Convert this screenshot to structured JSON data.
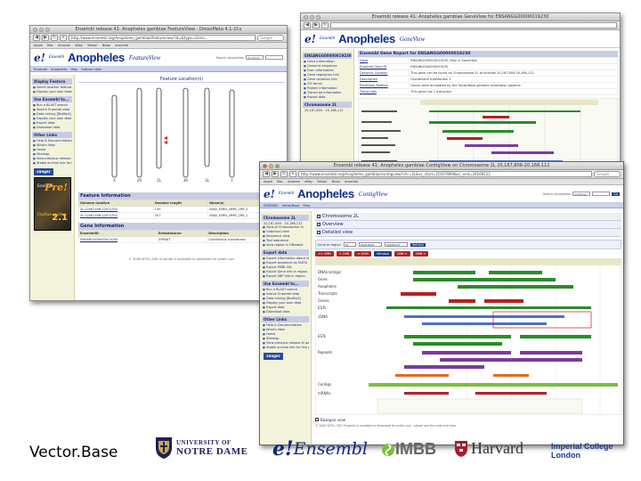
{
  "feature_window": {
    "title": "Ensembl release 41: Anopheles gambiae FeatureView - DrosoMeta 4.1-1f.x",
    "url": "http://www.ensembl.org/Anopheles_gambiae/featureview?id=&type=Gene...",
    "search_placeholder": "Google",
    "bookmarks": [
      "Apple",
      "Mac",
      "Amazon",
      "eBay",
      "Yahoo!",
      "News",
      "ensembl"
    ],
    "app_name": "Anopheles",
    "view_name": "FeatureView",
    "search_label": "Search Anopheles",
    "search_select": "Anything",
    "nav": [
      "Ensembl",
      "Anopheles",
      "Help",
      "Feature view"
    ],
    "sidebar": {
      "display_head": "Display Feature",
      "display_items": [
        "Select another feature to display",
        "Display your own features on a karyotype"
      ],
      "use_head": "Use Ensembl to...",
      "use_items": [
        "Run a BLAST search",
        "Search Ensembl data",
        "Data mining [BioMart]",
        "Display your own data",
        "Export data",
        "Download data"
      ],
      "links_head": "Other Links",
      "links_items": [
        "Help & Documentation",
        "What's New",
        "Home",
        "Sitemap",
        "View previous release of page in archive",
        "Stable archive link for this page"
      ],
      "sanger": "sanger",
      "pre_label": "Pre!",
      "pre_site": "Ensembl",
      "pre_species": "Gallus gallus",
      "pre_version": "2.1"
    },
    "panel_title": "Feature Location(s)",
    "info_title": "Feature Information",
    "info_headers": [
      "Genome location",
      "Genome length",
      "Name(s)"
    ],
    "info_rows": [
      [
        "2L:22067456-22071532",
        "149",
        "ARAV_EMBL_MMR_2R6_1"
      ],
      [
        "2L:22067456-22071531",
        "357",
        "ARAV_EMBL_MMR_2R6_1"
      ]
    ],
    "gene_title": "Gene Information",
    "gene_headers": [
      "EnsemblID",
      "Extdatatorun",
      "Description"
    ],
    "gene_rows": [
      [
        "ENSANGG00000011000",
        "GPRIWT",
        "Glutathione transferase"
      ]
    ],
    "footer": "© 2006 WTSI / EBI. Ensembl is available to download for public use."
  },
  "gene_window": {
    "title": "Ensembl release 41: Anopheles gambiae GeneView for ENSANGG00000019230",
    "app_name": "Anopheles",
    "view_name": "GeneView",
    "gene_title": "Ensembl Gene Report for ENSANGG00000019230",
    "rows": [
      [
        "Gene",
        "ENSANGG00000019230 View in GeneView"
      ],
      [
        "Ensembl Gene ID",
        "ENSANGG00000019230"
      ],
      [
        "Genomic Location",
        "This gene can be found on Chromosome 2L at location 20,167,809-20,168,112"
      ],
      [
        "Description",
        "Glutathione transferase 1"
      ],
      [
        "Prediction Method",
        "Genes were annotated by the VectorBase genome annotation pipeline"
      ],
      [
        "Transcripts",
        "This gene has 1 transcript"
      ]
    ],
    "sidebar_head": "ENSANGG00000019230",
    "sidebar_items": [
      "Gene information",
      "Genomic sequence",
      "Exon information",
      "Gene regulation info",
      "Gene variation info",
      "GO terms",
      "Protein information",
      "Transcript information",
      "Export data"
    ],
    "chrom_label": "Chromosome 2L",
    "chrom_range": "20,167,809 - 20,168,112"
  },
  "context_window": {
    "title": "Ensembl release 41: Anopheles gambiae ContigView on Chromosome 2L 20,167,809-20,168,112",
    "url": "http://www.ensembl.org/Anopheles_gambiae/contigview?chr=2L&vc_start=20167809&vc_end=20168112",
    "bookmarks": [
      "Apple",
      "Mac",
      "Amazon",
      "eBay",
      "Yahoo!",
      "News",
      "ensembl"
    ],
    "app_name": "Anopheles",
    "view_name": "ContigView",
    "search_label": "Search Anopheles",
    "search_select": "Anything",
    "nav_links": [
      "ENSEMBL",
      "VectorBase",
      "Help"
    ],
    "sidebar": {
      "chrom_head": "Chromosome 2L",
      "chrom_range": "20,167,809 - 20,168,112",
      "view_items": [
        "View of Chromosome 2L",
        "Graphical view",
        "Sequence view",
        "Text sequence",
        "View region in GBrowse"
      ],
      "export_head": "Export data",
      "export_items": [
        "Export information about region",
        "Export sequence as FASTA",
        "Export EMBL file",
        "Export Gene info in region",
        "Export SNP info in region"
      ],
      "use_head": "Use Ensembl to...",
      "use_items": [
        "Run a BLAST search",
        "Search Ensembl data",
        "Data mining [BioMart]",
        "Display your own data",
        "Export data",
        "Download data"
      ],
      "links_head": "Other Links",
      "links_items": [
        "Help & Documentation",
        "What's New",
        "Home",
        "Sitemap",
        "View previous release of page in archive",
        "Stable archive link for this page"
      ],
      "sanger": "sanger"
    },
    "sections": [
      "Chromosome 2L",
      "Overview",
      "Detailed view"
    ],
    "region_label": "Jump to region",
    "region_value": "2L",
    "region_start": "20167809",
    "region_end": "20168112",
    "refresh": "Refresh",
    "nav_buttons": [
      "<< 2MB",
      "< 1MB",
      "< 500k",
      "Window",
      "1MB >",
      "2MB >"
    ],
    "track_labels": [
      "DNA(contigs)",
      "Gene",
      "Anopheles",
      "Transcripts",
      "Genes",
      "ESTs",
      "cDNA",
      "ESTs",
      "Repeats",
      "Contigs",
      "mRNAs"
    ],
    "basepair": "Basepair view",
    "footer": "© 2006 WTSI / EBI. Ensembl is available to download for public use - please see the code and data"
  },
  "logos": {
    "vectorbase": "Vector.Base",
    "notre_dame": [
      "UNIVERSITY OF",
      "NOTRE DAME"
    ],
    "ensembl_e": "e!",
    "ensembl": "Ensembl",
    "imbb": "IMBB",
    "harvard": "Harvard",
    "imperial": [
      "Imperial College",
      "London"
    ]
  },
  "colors": {
    "ensembl_blue": "#0d2a8e",
    "sidebar_bg": "#f3f3dc",
    "section_head": "#c8cce3",
    "track_green": "#2a8c2a",
    "track_red": "#b22222",
    "track_purple": "#7a3c9c"
  }
}
